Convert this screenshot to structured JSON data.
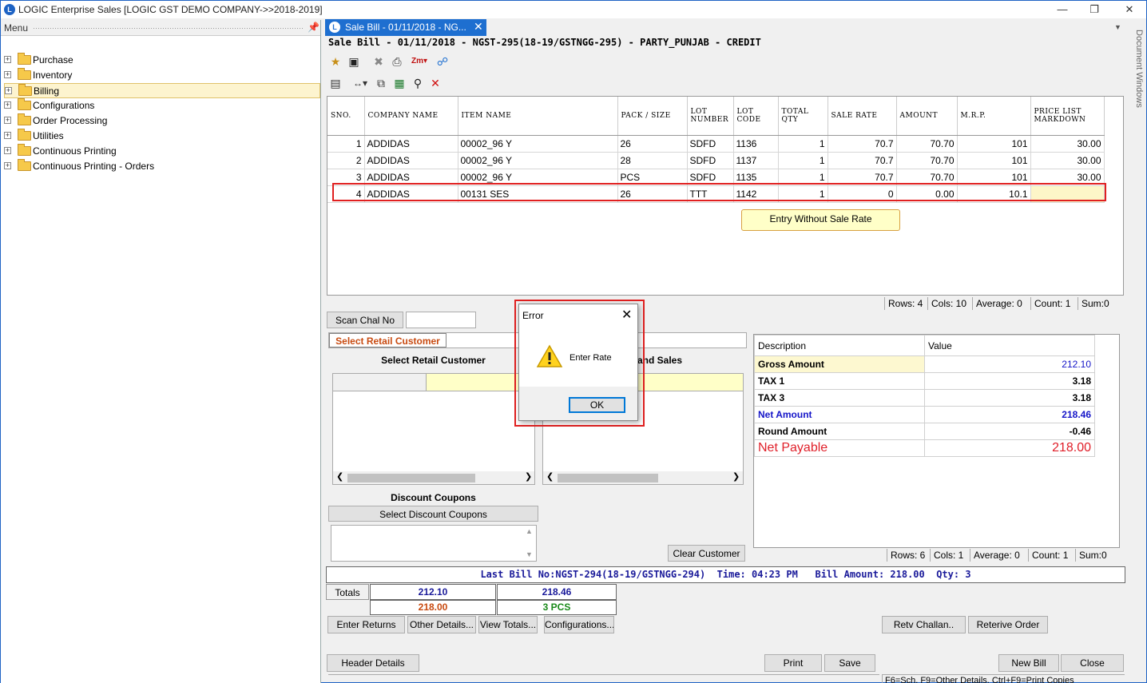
{
  "app": {
    "title": "LOGIC Enterprise Sales  [LOGIC GST DEMO COMPANY->>2018-2019]",
    "icon_letter": "L"
  },
  "menu": {
    "title": "Menu",
    "items": [
      {
        "label": "Purchase"
      },
      {
        "label": "Inventory"
      },
      {
        "label": "Billing"
      },
      {
        "label": "Configurations"
      },
      {
        "label": "Order Processing"
      },
      {
        "label": "Utilities"
      },
      {
        "label": "Continuous Printing"
      },
      {
        "label": "Continuous Printing - Orders"
      }
    ]
  },
  "tab": {
    "title": "Sale Bill - 01/11/2018 - NG..."
  },
  "bill_header": "Sale Bill - 01/11/2018 - NGST-295(18-19/GSTNGG-295) - PARTY_PUNJAB - CREDIT",
  "side_panel_label": "Document Windows",
  "grid": {
    "columns": [
      "SNO.",
      "COMPANY NAME",
      "ITEM NAME",
      "PACK / SIZE",
      "LOT NUMBER",
      "LOT CODE",
      "TOTAL QTY",
      "SALE RATE",
      "AMOUNT",
      "M.R.P.",
      "PRICE LIST MARKDOWN"
    ],
    "rows": [
      [
        "1",
        "ADDIDAS",
        "00002_96 Y",
        "26",
        "SDFD",
        "1136",
        "1",
        "70.7",
        "70.70",
        "101",
        "30.00"
      ],
      [
        "2",
        "ADDIDAS",
        "00002_96 Y",
        "28",
        "SDFD",
        "1137",
        "1",
        "70.7",
        "70.70",
        "101",
        "30.00"
      ],
      [
        "3",
        "ADDIDAS",
        "00002_96 Y",
        "PCS",
        "SDFD",
        "1135",
        "1",
        "70.7",
        "70.70",
        "101",
        "30.00"
      ],
      [
        "4",
        "ADDIDAS",
        "00131 SES",
        "26",
        "TTT",
        "1142",
        "1",
        "0",
        "0.00",
        "10.1",
        ""
      ]
    ],
    "annotation": "Entry Without Sale Rate",
    "status": {
      "rows": "Rows: 4",
      "cols": "Cols: 10",
      "average": "Average: 0",
      "count": "Count: 1",
      "sum": "Sum:0"
    }
  },
  "scan_chal_label": "Scan Chal No",
  "retail": {
    "select_button": "Select Retail Customer",
    "panel_title": "Select Retail Customer",
    "other_panel_title": "and Sales"
  },
  "discount": {
    "title": "Discount Coupons",
    "button": "Select Discount Coupons"
  },
  "clear_customer": "Clear Customer",
  "summary": {
    "headers": [
      "Description",
      "Value"
    ],
    "rows": [
      {
        "desc": "Gross Amount",
        "value": "212.10"
      },
      {
        "desc": "TAX 1",
        "value": "3.18"
      },
      {
        "desc": "TAX 3",
        "value": "3.18"
      },
      {
        "desc": "Net Amount",
        "value": "218.46"
      },
      {
        "desc": "Round Amount",
        "value": "-0.46"
      },
      {
        "desc": "Net Payable",
        "value": "218.00"
      }
    ],
    "status": {
      "rows": "Rows: 6",
      "cols": "Cols: 1",
      "average": "Average: 0",
      "count": "Count: 1",
      "sum": "Sum:0"
    }
  },
  "last_bill": "Last Bill No:NGST-294(18-19/GSTNGG-294)  Time: 04:23 PM   Bill Amount: 218.00  Qty: 3",
  "totals": {
    "label": "Totals",
    "gross": "212.10",
    "net": "218.46",
    "payable": "218.00",
    "qty": "3 PCS"
  },
  "buttons": {
    "enter_returns": "Enter Returns",
    "other_details": "Other Details...",
    "view_totals": "View Totals...",
    "configurations": "Configurations...",
    "retv_challan": "Retv Challan..",
    "retrieve_order": "Reterive Order",
    "header_details": "Header Details",
    "print": "Print",
    "save": "Save",
    "new_bill": "New Bill",
    "close": "Close"
  },
  "shortcut_hint": "F6=Sch, F9=Other Details, Ctrl+F9=Print Copies",
  "dialog": {
    "title": "Error",
    "message": "Enter Rate",
    "ok": "OK"
  },
  "colors": {
    "accent": "#1e6fd0",
    "error_red": "#e02020",
    "value_blue": "#1515c8",
    "payable_red": "#e0202a",
    "totals_orange": "#c84a10",
    "totals_green": "#1a8a1a"
  }
}
